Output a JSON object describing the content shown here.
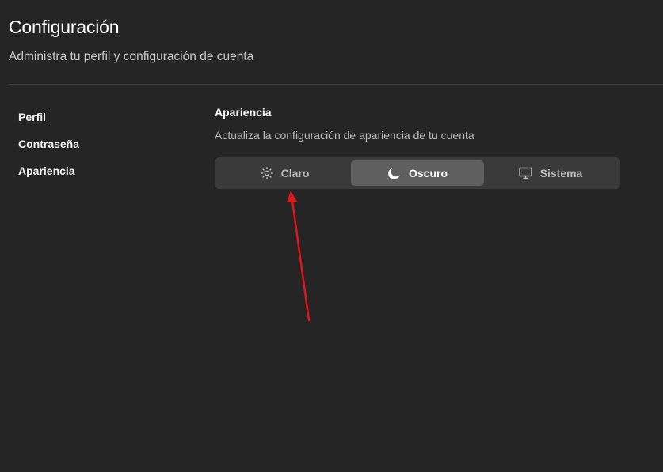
{
  "header": {
    "title": "Configuración",
    "subtitle": "Administra tu perfil y configuración de cuenta"
  },
  "sidebar": {
    "items": [
      {
        "label": "Perfil"
      },
      {
        "label": "Contraseña"
      },
      {
        "label": "Apariencia"
      }
    ]
  },
  "appearance": {
    "title": "Apariencia",
    "description": "Actualiza la configuración de apariencia de tu cuenta",
    "options": [
      {
        "label": "Claro",
        "icon": "sun-icon",
        "selected": false
      },
      {
        "label": "Oscuro",
        "icon": "moon-icon",
        "selected": true
      },
      {
        "label": "Sistema",
        "icon": "monitor-icon",
        "selected": false
      }
    ]
  },
  "colors": {
    "background": "#252525",
    "active_segment": "#5f5f5f",
    "annotation_arrow": "#e0161b"
  }
}
